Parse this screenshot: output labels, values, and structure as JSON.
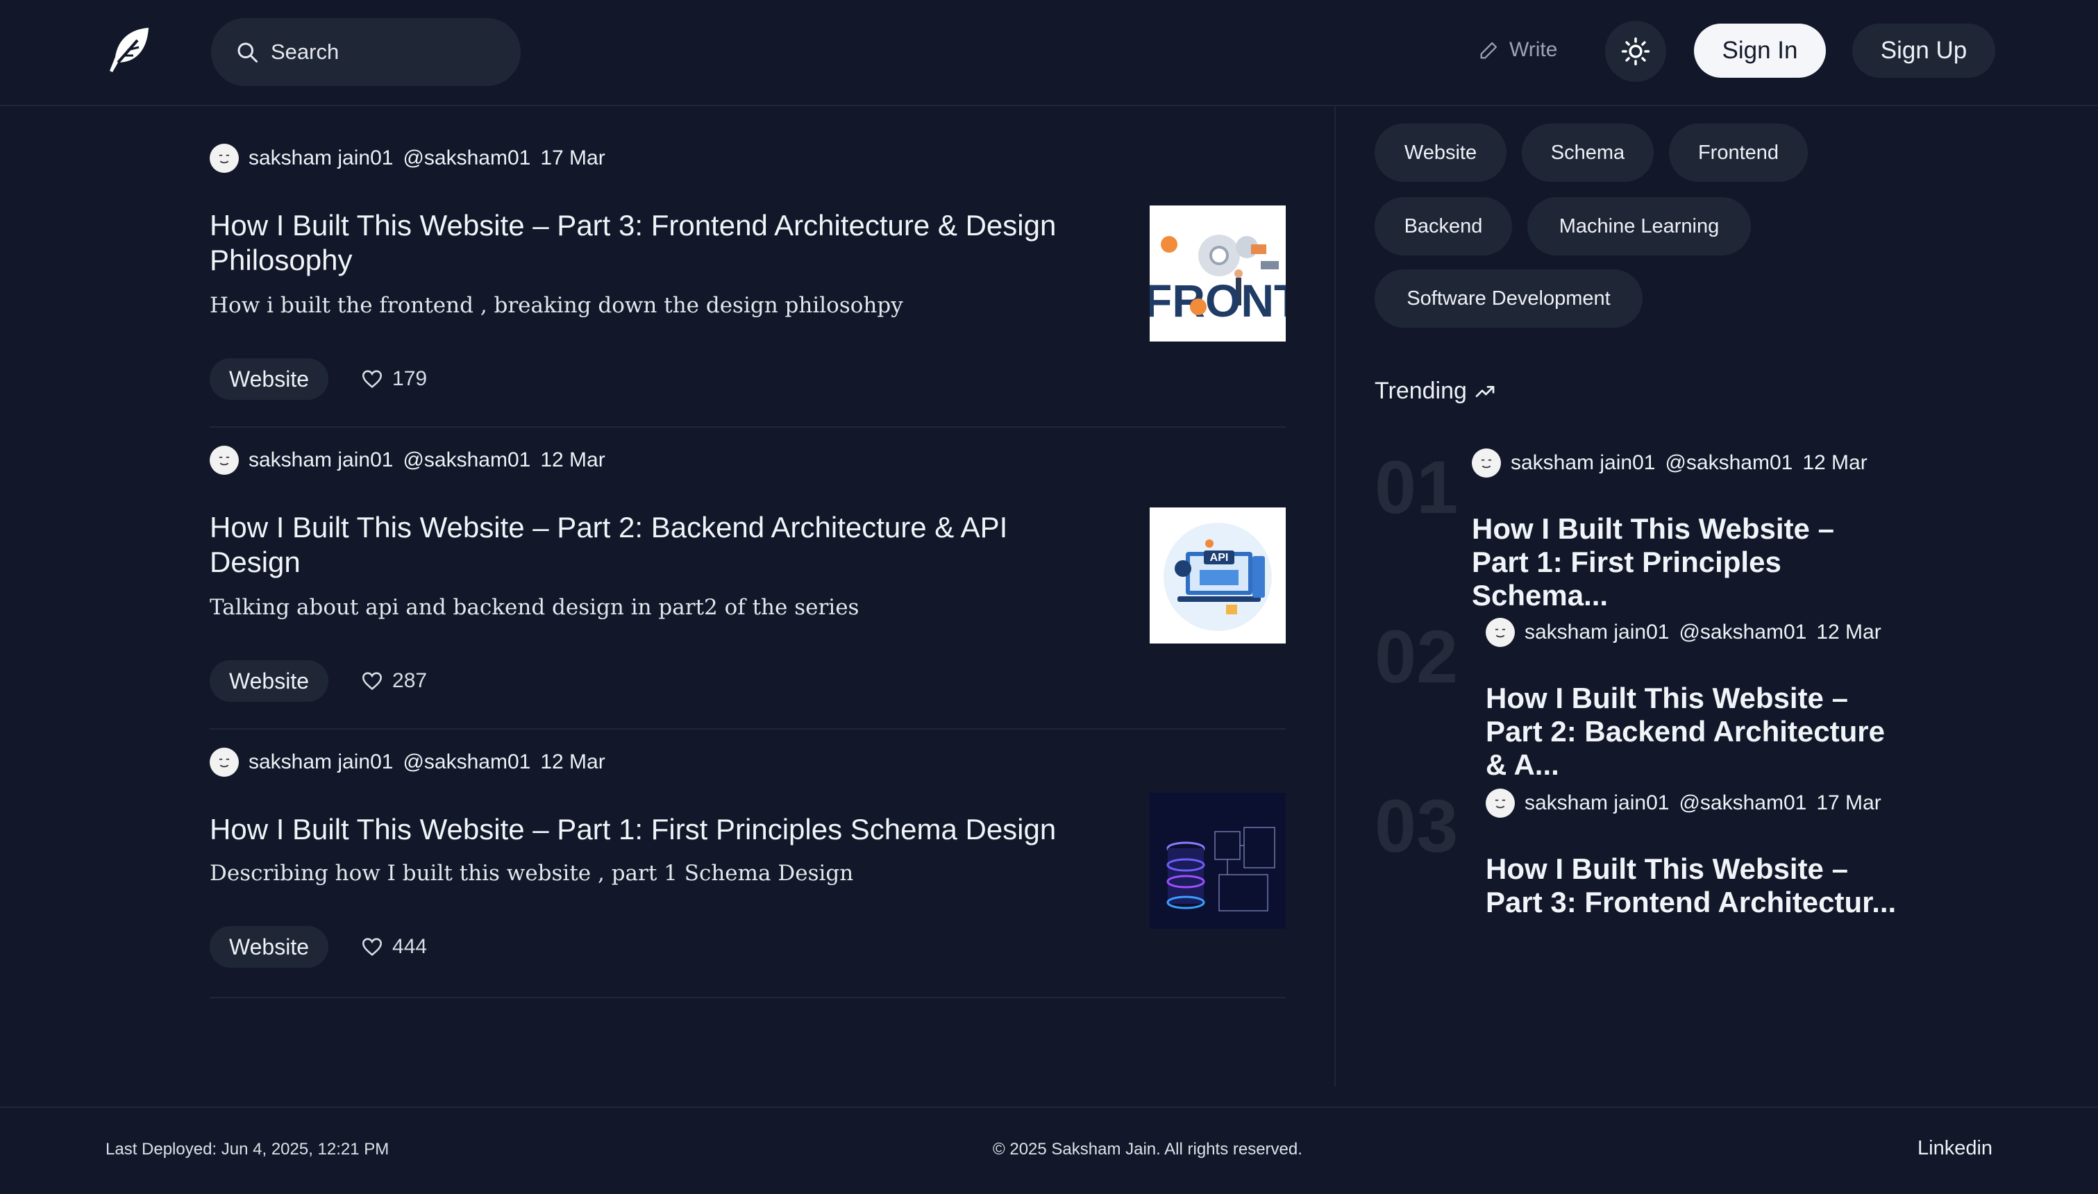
{
  "header": {
    "search_placeholder": "Search",
    "write_label": "Write",
    "sign_in_label": "Sign In",
    "sign_up_label": "Sign Up"
  },
  "posts": [
    {
      "author": "saksham jain01",
      "handle": "@saksham01",
      "date": "17 Mar",
      "title": "How I Built This Website – Part 3: Frontend Architecture & Design Philosophy",
      "subtitle": "How i built the frontend , breaking down the design philosohpy",
      "tag": "Website",
      "likes": "179",
      "thumb_text": "FRONTEND"
    },
    {
      "author": "saksham jain01",
      "handle": "@saksham01",
      "date": "12 Mar",
      "title": "How I Built This Website – Part 2: Backend Architecture & API Design",
      "subtitle": "Talking about api and backend design in part2 of the series",
      "tag": "Website",
      "likes": "287",
      "thumb_text": "API"
    },
    {
      "author": "saksham jain01",
      "handle": "@saksham01",
      "date": "12 Mar",
      "title": "How I Built This Website – Part 1: First Principles Schema Design",
      "subtitle": "Describing how I built this website , part 1 Schema Design",
      "tag": "Website",
      "likes": "444"
    }
  ],
  "tags": [
    "Website",
    "Schema",
    "Frontend",
    "Backend",
    "Machine Learning",
    "Software Development"
  ],
  "trending": {
    "heading": "Trending",
    "items": [
      {
        "num": "01",
        "author": "saksham jain01",
        "handle": "@saksham01",
        "date": "12 Mar",
        "title": "How I Built This Website – Part 1: First Principles Schema..."
      },
      {
        "num": "02",
        "author": "saksham jain01",
        "handle": "@saksham01",
        "date": "12 Mar",
        "title": "How I Built This Website – Part 2: Backend Architecture & A..."
      },
      {
        "num": "03",
        "author": "saksham jain01",
        "handle": "@saksham01",
        "date": "17 Mar",
        "title": "How I Built This Website – Part 3: Frontend Architectur..."
      }
    ]
  },
  "footer": {
    "deployed": "Last Deployed: Jun 4, 2025, 12:21 PM",
    "copyright": "© 2025 Saksham Jain. All rights reserved.",
    "linkedin": "Linkedin"
  },
  "colors": {
    "background": "#121829",
    "surface": "#1f2737",
    "accent_light": "#f4f6f9"
  }
}
